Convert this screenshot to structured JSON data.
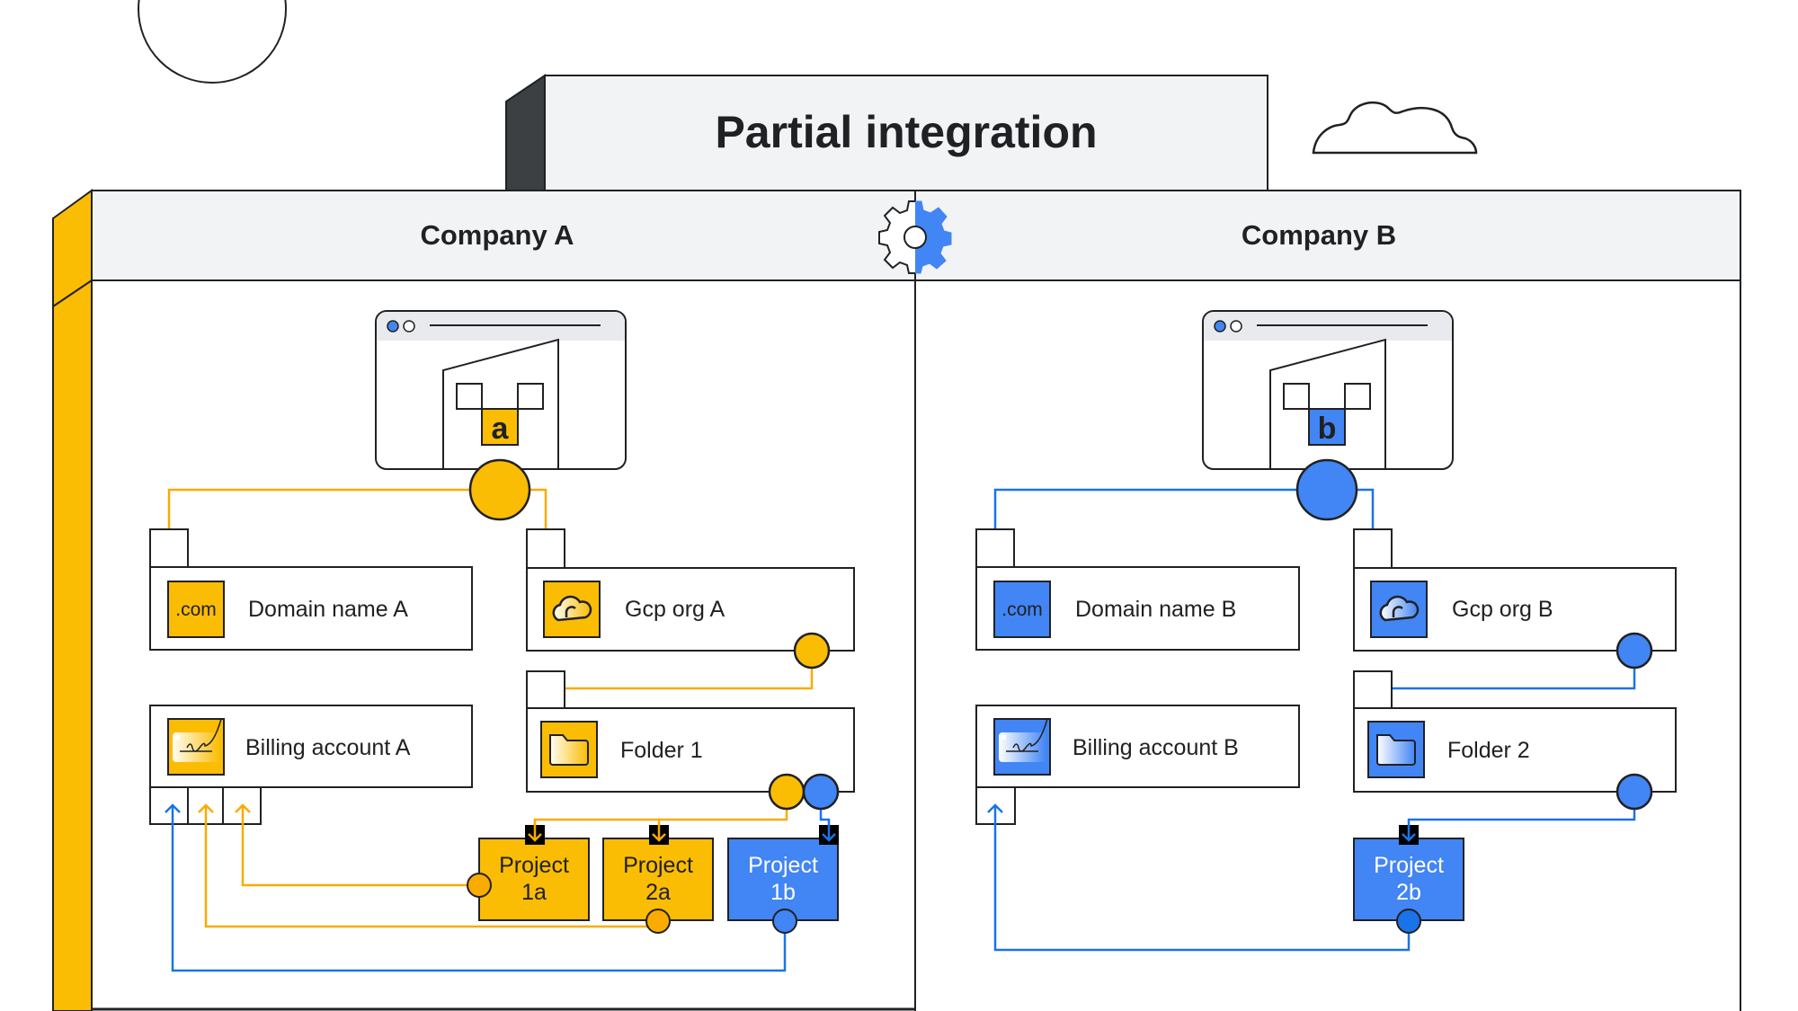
{
  "title": "Partial integration",
  "colors": {
    "company_a": "#FBBC04",
    "company_b": "#4285F4",
    "header_bg": "#F1F3F4",
    "outline": "#202124",
    "title_side": "#3C4043"
  },
  "integration_icon": "gear-icon",
  "company_a": {
    "name": "Company A",
    "org_letter": "a",
    "resources": {
      "domain": {
        "label": "Domain name A",
        "icon_text": ".com",
        "icon": "domain-icon"
      },
      "gcp_org": {
        "label": "Gcp org A",
        "icon": "cloud-icon"
      },
      "billing": {
        "label": "Billing account A",
        "icon": "credit-card-icon"
      },
      "folder": {
        "label": "Folder 1",
        "icon": "folder-icon"
      }
    },
    "projects": [
      {
        "line1": "Project",
        "line2": "1a",
        "owner": "A"
      },
      {
        "line1": "Project",
        "line2": "2a",
        "owner": "A"
      },
      {
        "line1": "Project",
        "line2": "1b",
        "owner": "B"
      }
    ]
  },
  "company_b": {
    "name": "Company B",
    "org_letter": "b",
    "resources": {
      "domain": {
        "label": "Domain name B",
        "icon_text": ".com",
        "icon": "domain-icon"
      },
      "gcp_org": {
        "label": "Gcp org B",
        "icon": "cloud-icon"
      },
      "billing": {
        "label": "Billing account B",
        "icon": "credit-card-icon"
      },
      "folder": {
        "label": "Folder 2",
        "icon": "folder-icon"
      }
    },
    "projects": [
      {
        "line1": "Project",
        "line2": "2b",
        "owner": "B"
      }
    ]
  }
}
